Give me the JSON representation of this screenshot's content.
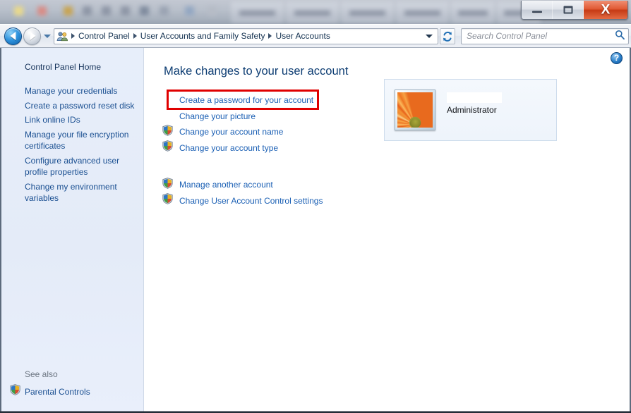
{
  "window": {
    "caption_buttons": [
      {
        "name": "minimize",
        "glyph": "minimize-icon",
        "title": "Minimize"
      },
      {
        "name": "maximize",
        "glyph": "maximize-icon",
        "title": "Maximize"
      },
      {
        "name": "close",
        "glyph": "close-icon",
        "title": "Close",
        "label": "X",
        "color": "#c63a15"
      }
    ]
  },
  "background_strip": {
    "description": "blurred partially-visible window behind",
    "tabs": [
      "",
      "",
      "",
      "",
      "",
      ""
    ]
  },
  "addressbar": {
    "back_button": {
      "icon": "back-arrow-icon",
      "enabled": true
    },
    "forward_button": {
      "icon": "forward-arrow-icon",
      "enabled": false
    },
    "recent_pages_icon": "chevron-down-icon",
    "breadcrumb_icon": "user-accounts-icon",
    "breadcrumbs": [
      "Control Panel",
      "User Accounts and Family Safety",
      "User Accounts"
    ],
    "breadcrumb_dropdown_icon": "chevron-down-icon",
    "refresh_icon": "refresh-icon",
    "search": {
      "placeholder": "Search Control Panel",
      "value": "",
      "icon": "search-icon"
    }
  },
  "sidebar": {
    "home_label": "Control Panel Home",
    "items": [
      {
        "label": "Manage your credentials"
      },
      {
        "label": "Create a password reset disk"
      },
      {
        "label": "Link online IDs"
      },
      {
        "label": "Manage your file encryption certificates"
      },
      {
        "label": "Configure advanced user profile properties"
      },
      {
        "label": "Change my environment variables"
      }
    ],
    "see_also": {
      "label": "See also",
      "items": [
        {
          "label": "Parental Controls",
          "icon": "uac-shield-icon"
        }
      ]
    }
  },
  "content": {
    "help_button": {
      "label": "?",
      "icon": "help-icon"
    },
    "title": "Make changes to your user account",
    "primary_links": [
      {
        "label": "Create a password for your account",
        "shield": false,
        "highlighted": true
      },
      {
        "label": "Change your picture",
        "shield": false,
        "highlighted": false
      },
      {
        "label": "Change your account name",
        "shield": true,
        "highlighted": false
      },
      {
        "label": "Change your account type",
        "shield": true,
        "highlighted": false
      }
    ],
    "secondary_links": [
      {
        "label": "Manage another account",
        "shield": true
      },
      {
        "label": "Change User Account Control settings",
        "shield": true
      }
    ],
    "highlight_color": "#e00000",
    "account_panel": {
      "avatar_icon": "flower-avatar-icon",
      "account_name_redacted": true,
      "account_role": "Administrator"
    }
  }
}
